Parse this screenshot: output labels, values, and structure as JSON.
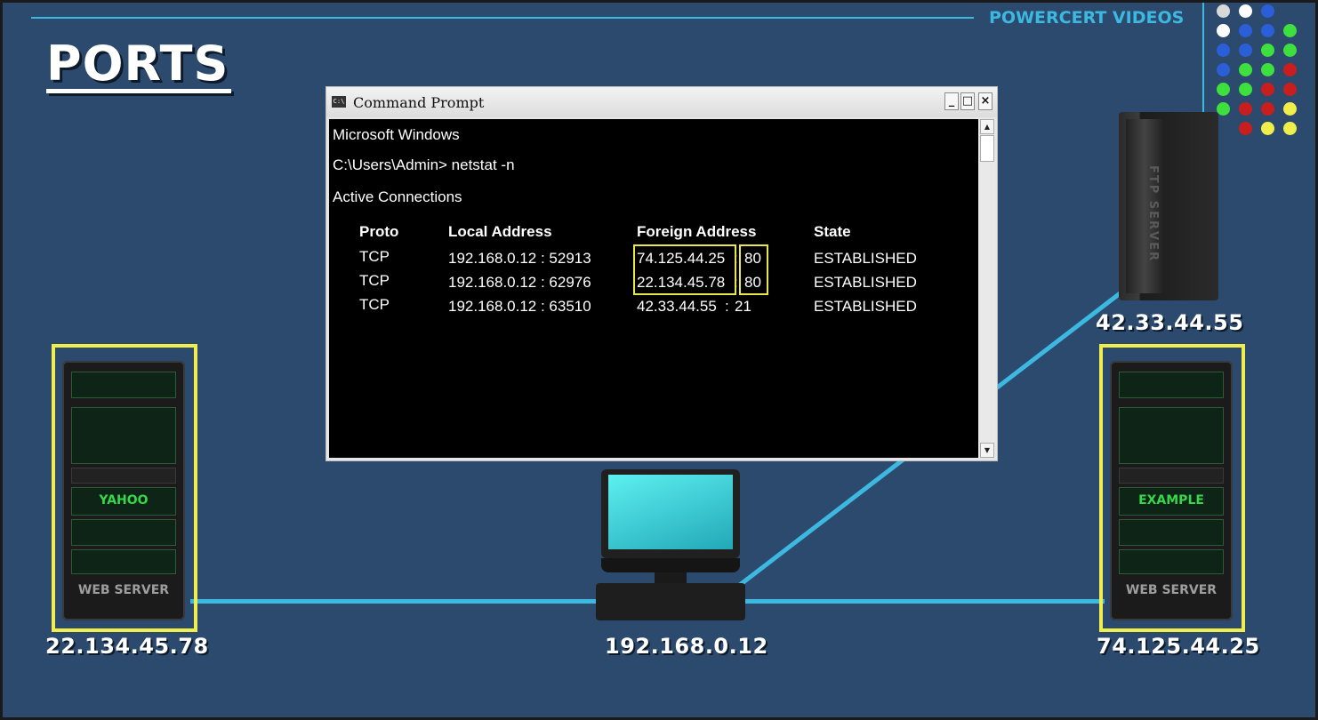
{
  "slide": {
    "title": "PORTS",
    "brand": "POWERCERT VIDEOS"
  },
  "cmd": {
    "window_title": "Command Prompt",
    "icon_text": "C:\\",
    "controls": {
      "minimize": "_",
      "maximize": "□",
      "close": "×"
    },
    "lines": {
      "os": "Microsoft Windows",
      "command": "C:\\Users\\Admin>  netstat -n",
      "section": "Active Connections"
    },
    "headers": {
      "proto": "Proto",
      "local": "Local Address",
      "foreign": "Foreign Address",
      "state": "State"
    },
    "rows": [
      {
        "proto": "TCP",
        "local": "192.168.0.12 : 52913",
        "foreign_ip": "74.125.44.25",
        "sep": ":",
        "port": "80",
        "state": "ESTABLISHED"
      },
      {
        "proto": "TCP",
        "local": "192.168.0.12 : 62976",
        "foreign_ip": "22.134.45.78",
        "sep": ":",
        "port": "80",
        "state": "ESTABLISHED"
      },
      {
        "proto": "TCP",
        "local": "192.168.0.12 : 63510",
        "foreign_ip": "42.33.44.55",
        "sep": ":",
        "port": "21",
        "state": "ESTABLISHED"
      }
    ]
  },
  "devices": {
    "web_server_left": {
      "brand": "YAHOO",
      "label": "WEB SERVER",
      "ip": "22.134.45.78"
    },
    "web_server_right": {
      "brand": "EXAMPLE",
      "label": "WEB SERVER",
      "ip": "74.125.44.25"
    },
    "ftp_server": {
      "label": "FTP SERVER",
      "ip": "42.33.44.55"
    },
    "desktop": {
      "ip": "192.168.0.12"
    }
  },
  "colors": {
    "background": "#2c4a6e",
    "accent": "#3db8e0",
    "highlight": "#f0ee4a"
  }
}
